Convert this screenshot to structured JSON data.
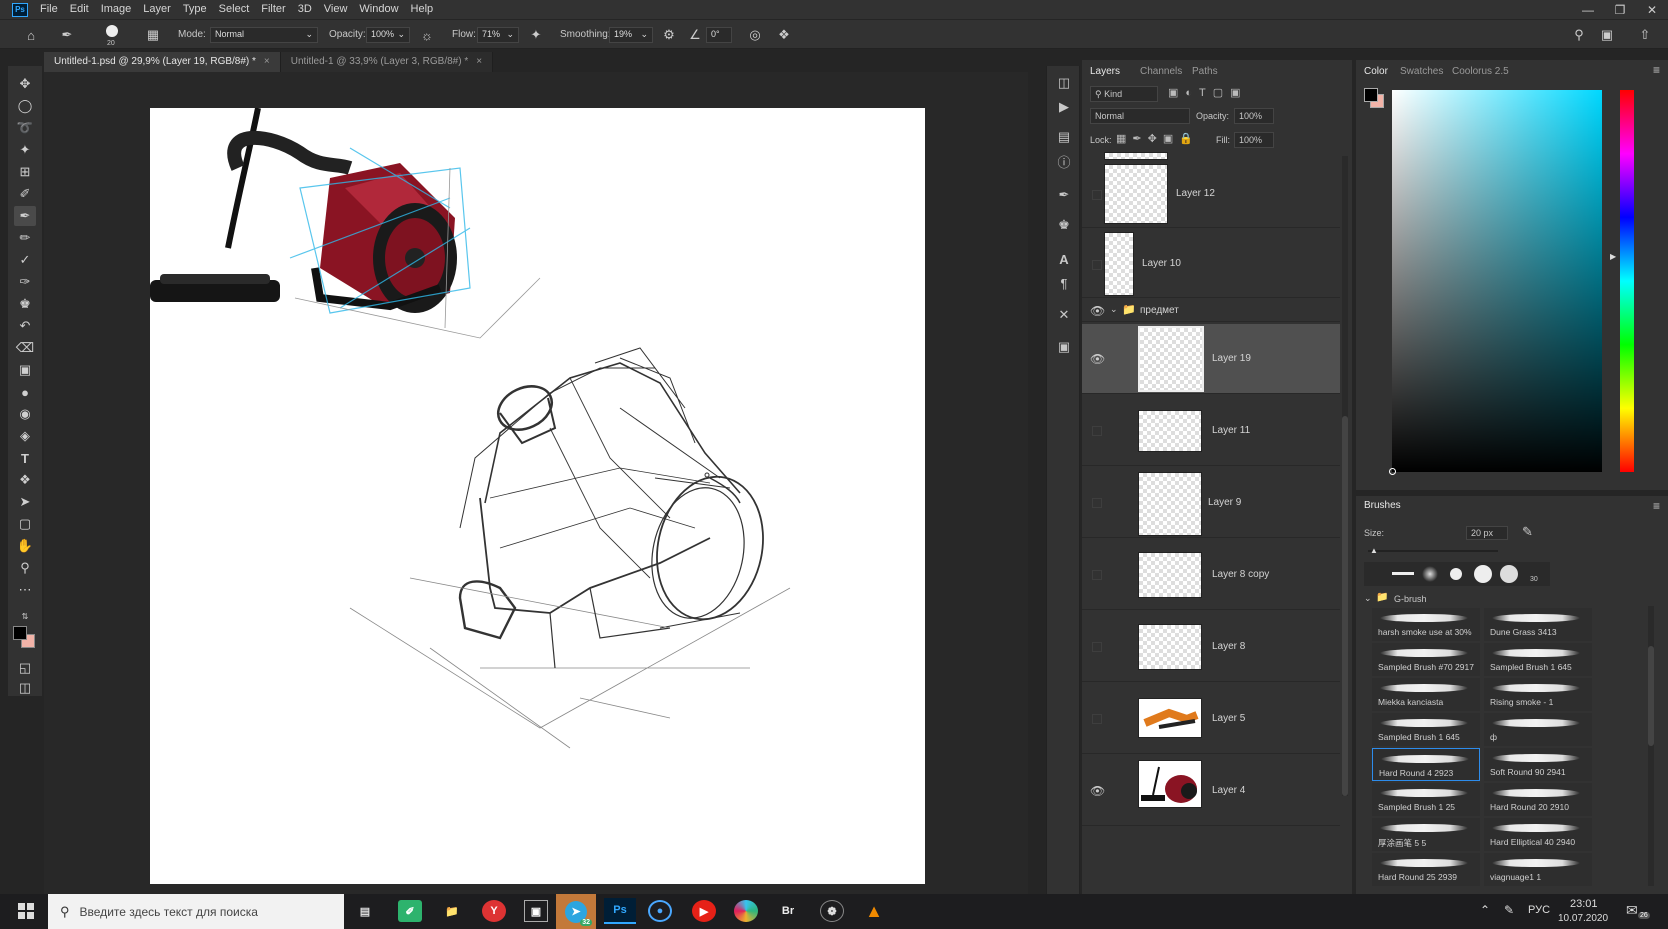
{
  "app": {
    "logo_text": "Ps"
  },
  "menu": [
    "File",
    "Edit",
    "Image",
    "Layer",
    "Type",
    "Select",
    "Filter",
    "3D",
    "View",
    "Window",
    "Help"
  ],
  "options": {
    "brush_size": "20",
    "mode_label": "Mode:",
    "mode_value": "Normal",
    "opacity_label": "Opacity:",
    "opacity_value": "100%",
    "flow_label": "Flow:",
    "flow_value": "71%",
    "smoothing_label": "Smoothing:",
    "smoothing_value": "19%",
    "angle_value": "0°"
  },
  "doc_tabs": [
    {
      "label": "Untitled-1.psd @ 29,9% (Layer 19, RGB/8#) *",
      "active": true
    },
    {
      "label": "Untitled-1 @ 33,9% (Layer 3, RGB/8#) *",
      "active": false
    }
  ],
  "layers_panel": {
    "tabs": [
      "Layers",
      "Channels",
      "Paths"
    ],
    "kind_filter": "Kind",
    "blend_mode": "Normal",
    "opacity_label": "Opacity:",
    "opacity_value": "100%",
    "lock_label": "Lock:",
    "fill_label": "Fill:",
    "fill_value": "100%",
    "group_name": "предмет",
    "layers": [
      {
        "name": "Layer 12",
        "visible": false
      },
      {
        "name": "Layer 10",
        "visible": false
      },
      {
        "name": "Layer 19",
        "visible": true
      },
      {
        "name": "Layer 11",
        "visible": false
      },
      {
        "name": "Layer 9",
        "visible": false
      },
      {
        "name": "Layer 8 copy",
        "visible": false
      },
      {
        "name": "Layer 8",
        "visible": false
      },
      {
        "name": "Layer 5",
        "visible": false
      },
      {
        "name": "Layer 4",
        "visible": true
      }
    ]
  },
  "color_panel": {
    "tabs": [
      "Color",
      "Swatches",
      "Coolorus 2.5"
    ],
    "foreground": "#000000",
    "background": "#f2b3a8",
    "hue": "#00d8ff"
  },
  "brushes_panel": {
    "title": "Brushes",
    "size_label": "Size:",
    "size_value": "20 px",
    "preset_badge": "30",
    "folder_name": "G-brush",
    "brushes": [
      {
        "name": "harsh smoke use at 30%"
      },
      {
        "name": "Dune Grass 3413"
      },
      {
        "name": "Sampled Brush #70 2917"
      },
      {
        "name": "Sampled Brush 1 645"
      },
      {
        "name": "Miekka kanciasta"
      },
      {
        "name": "Rising smoke - 1"
      },
      {
        "name": "Sampled Brush 1 645"
      },
      {
        "name": "ф"
      },
      {
        "name": "Hard Round 4 2923"
      },
      {
        "name": "Soft Round 90 2941"
      },
      {
        "name": "Sampled Brush 1 25"
      },
      {
        "name": "Hard Round 20 2910"
      },
      {
        "name": "厚涂画笔 5 5"
      },
      {
        "name": "Hard Elliptical 40 2940"
      },
      {
        "name": "Hard Round 25 2939"
      },
      {
        "name": "viagnuage1 1"
      }
    ],
    "selected_index": 8
  },
  "taskbar": {
    "search_placeholder": "Введите здесь текст для поиска",
    "telegram_badge": "32",
    "bridge_label": "Br",
    "language": "РУС",
    "time": "23:01",
    "date": "10.07.2020",
    "notification_count": "26"
  }
}
